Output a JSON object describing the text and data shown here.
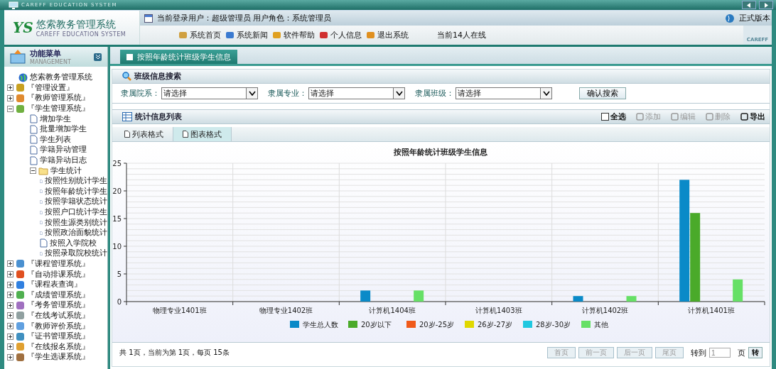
{
  "top_bar": {
    "caption": "CAREFF EDUCATION SYSTEM"
  },
  "header": {
    "logo_mark": "YS",
    "title": "悠索教务管理系统",
    "subtitle": "CAREFF EDUCATION SYSTEM",
    "user_info": "当前登录用户：超级管理员 用户角色：系统管理员",
    "edition": "正式版本",
    "nav": [
      {
        "label": "系统首页",
        "color": "#d0a040"
      },
      {
        "label": "系统新闻",
        "color": "#3a7ad0"
      },
      {
        "label": "软件帮助",
        "color": "#e0a020"
      },
      {
        "label": "个人信息",
        "color": "#d03030"
      },
      {
        "label": "退出系统",
        "color": "#e09020"
      }
    ],
    "online": "当前14人在线",
    "brand": "CAREFF"
  },
  "sidebar": {
    "title": "功能菜单",
    "subtitle": "MANAGEMENT",
    "tree": {
      "label": "悠索教务管理系统",
      "children": [
        {
          "label": "『管理设置』",
          "expanded": false,
          "color": "#c8a020"
        },
        {
          "label": "『教师管理系统』",
          "expanded": false,
          "color": "#e08a30"
        },
        {
          "label": "『学生管理系统』",
          "expanded": true,
          "color": "#70b040",
          "children": [
            {
              "label": "增加学生"
            },
            {
              "label": "批量增加学生"
            },
            {
              "label": "学生列表"
            },
            {
              "label": "学籍异动管理"
            },
            {
              "label": "学籍异动日志"
            },
            {
              "label": "学生统计",
              "expanded": true,
              "children": [
                {
                  "label": "按照性别统计学生"
                },
                {
                  "label": "按照年龄统计学生"
                },
                {
                  "label": "按照学籍状态统计"
                },
                {
                  "label": "按照户口统计学生"
                },
                {
                  "label": "按照生源类别统计"
                },
                {
                  "label": "按照政治面貌统计"
                },
                {
                  "label": "按照入学院校"
                },
                {
                  "label": "按照录取院校统计"
                }
              ]
            }
          ]
        },
        {
          "label": "『课程管理系统』",
          "expanded": false,
          "color": "#4a90d0"
        },
        {
          "label": "『自动排课系统』",
          "expanded": false,
          "color": "#e05020"
        },
        {
          "label": "『课程表查询』",
          "expanded": false,
          "color": "#3080e0"
        },
        {
          "label": "『成绩管理系统』",
          "expanded": false,
          "color": "#50b050"
        },
        {
          "label": "『考务管理系统』",
          "expanded": false,
          "color": "#a070c0"
        },
        {
          "label": "『在线考试系统』",
          "expanded": false,
          "color": "#90a0a0"
        },
        {
          "label": "『教师评价系统』",
          "expanded": false,
          "color": "#60a0e0"
        },
        {
          "label": "『证书管理系统』",
          "expanded": false,
          "color": "#4090c0"
        },
        {
          "label": "『在线报名系统』",
          "expanded": false,
          "color": "#e0a030"
        },
        {
          "label": "『学生选课系统』",
          "expanded": false,
          "color": "#a07040"
        }
      ]
    }
  },
  "main_tab": {
    "label": "按照年龄统计班级学生信息"
  },
  "search": {
    "title": "班级信息搜索",
    "fields": [
      {
        "label": "隶属院系：",
        "value": "请选择"
      },
      {
        "label": "隶属专业：",
        "value": "请选择"
      },
      {
        "label": "隶属班级：",
        "value": "请选择"
      }
    ],
    "button": "确认搜索"
  },
  "stats": {
    "title": "统计信息列表",
    "select_all": {
      "label": "全选",
      "checked": false
    },
    "actions": [
      {
        "label": "添加",
        "disabled": true
      },
      {
        "label": "编辑",
        "disabled": true
      },
      {
        "label": "删除",
        "disabled": true
      },
      {
        "label": "导出",
        "disabled": false
      }
    ],
    "view_tabs": [
      {
        "label": "列表格式",
        "selected": false
      },
      {
        "label": "图表格式",
        "selected": true
      }
    ],
    "chart_data": {
      "type": "bar",
      "title": "按照年龄统计班级学生信息",
      "categories": [
        "物理专业1401班",
        "物理专业1402班",
        "计算机1404班",
        "计算机1403班",
        "计算机1402班",
        "计算机1401班"
      ],
      "series": [
        {
          "name": "学生总人数",
          "color": "#0a8ac8",
          "values": [
            0,
            0,
            2,
            0,
            1,
            22
          ]
        },
        {
          "name": "20岁以下",
          "color": "#4aaa2a",
          "values": [
            0,
            0,
            0,
            0,
            0,
            16
          ]
        },
        {
          "name": "20岁-25岁",
          "color": "#f05a1a",
          "values": [
            0,
            0,
            0,
            0,
            0,
            0
          ]
        },
        {
          "name": "26岁-27岁",
          "color": "#e0d800",
          "values": [
            0,
            0,
            0,
            0,
            0,
            0
          ]
        },
        {
          "name": "28岁-30岁",
          "color": "#20c8e0",
          "values": [
            0,
            0,
            0,
            0,
            0,
            0
          ]
        },
        {
          "name": "其他",
          "color": "#66e066",
          "values": [
            0,
            0,
            2,
            0,
            1,
            4
          ]
        }
      ],
      "ylim": [
        0,
        25
      ],
      "yticks": [
        0,
        5,
        10,
        15,
        20,
        25
      ],
      "grid": true,
      "legend": true
    }
  },
  "pagination": {
    "summary": "共 1页，当前为第 1页，每页 15条",
    "buttons": [
      {
        "label": "首页",
        "disabled": true
      },
      {
        "label": "前一页",
        "disabled": true
      },
      {
        "label": "后一页",
        "disabled": true
      },
      {
        "label": "尾页",
        "disabled": true
      }
    ],
    "goto_label": "转到",
    "page_value": "1",
    "page_unit": "页",
    "go_button": "转"
  }
}
